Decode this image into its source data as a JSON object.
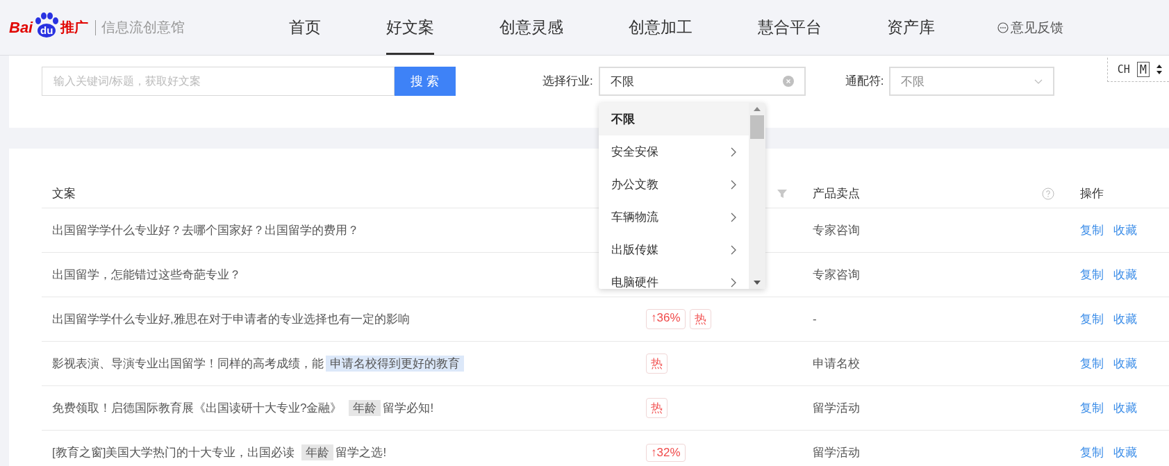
{
  "header": {
    "logo": {
      "parts": [
        "Bai",
        "du",
        "推广"
      ]
    },
    "subtitle": "信息流创意馆",
    "nav": [
      {
        "label": "首页",
        "selected": false
      },
      {
        "label": "好文案",
        "selected": true
      },
      {
        "label": "创意灵感",
        "selected": false
      },
      {
        "label": "创意加工",
        "selected": false
      },
      {
        "label": "慧合平台",
        "selected": false
      },
      {
        "label": "资产库",
        "selected": false
      }
    ],
    "feedback": "意见反馈"
  },
  "search": {
    "placeholder": "输入关键词/标题，获取好文案",
    "button": "搜 索"
  },
  "industry": {
    "label": "选择行业:",
    "value": "不限",
    "options": [
      {
        "label": "不限",
        "selected": true,
        "has_children": false
      },
      {
        "label": "安全安保",
        "selected": false,
        "has_children": true
      },
      {
        "label": "办公文教",
        "selected": false,
        "has_children": true
      },
      {
        "label": "车辆物流",
        "selected": false,
        "has_children": true
      },
      {
        "label": "出版传媒",
        "selected": false,
        "has_children": true
      },
      {
        "label": "电脑硬件",
        "selected": false,
        "has_children": true
      }
    ]
  },
  "wildcard": {
    "label": "通配符:",
    "value": "不限"
  },
  "ime": {
    "mode": "CH",
    "key": "M"
  },
  "table": {
    "columns": [
      {
        "label": "文案"
      },
      {
        "label": "产品卖点"
      },
      {
        "label": "操作"
      }
    ],
    "rows": [
      {
        "text": [
          {
            "text": "出国留学学什么专业好？去哪个国家好？出国留学的费用？",
            "kind": "plain"
          }
        ],
        "tags": [],
        "selling_point": "专家咨询",
        "actions": [
          "复制",
          "收藏"
        ]
      },
      {
        "text": [
          {
            "text": "出国留学，怎能错过这些奇葩专业？",
            "kind": "plain"
          }
        ],
        "tags": [],
        "selling_point": "专家咨询",
        "actions": [
          "复制",
          "收藏"
        ]
      },
      {
        "text": [
          {
            "text": "出国留学学什么专业好,雅思在对于申请者的专业选择也有一定的影响",
            "kind": "plain"
          }
        ],
        "tags": [
          {
            "text": "↑36%",
            "kind": "rise"
          },
          {
            "text": "热",
            "kind": "hot"
          }
        ],
        "selling_point": "-",
        "actions": [
          "复制",
          "收藏"
        ]
      },
      {
        "text": [
          {
            "text": "影视表演、导演专业出国留学！同样的高考成绩，能",
            "kind": "plain"
          },
          {
            "text": "申请名校得到更好的教育",
            "kind": "highlight"
          }
        ],
        "tags": [
          {
            "text": "热",
            "kind": "hot"
          }
        ],
        "selling_point": "申请名校",
        "actions": [
          "复制",
          "收藏"
        ]
      },
      {
        "text": [
          {
            "text": "免费领取！启德国际教育展《出国读研十大专业?金融》",
            "kind": "plain"
          },
          {
            "text": "年龄",
            "kind": "wildcard"
          },
          {
            "text": "留学必知!",
            "kind": "plain"
          }
        ],
        "tags": [
          {
            "text": "热",
            "kind": "hot"
          }
        ],
        "selling_point": "留学活动",
        "actions": [
          "复制",
          "收藏"
        ]
      },
      {
        "text": [
          {
            "text": "[教育之窗]美国大学热门的十大专业，出国必读",
            "kind": "plain"
          },
          {
            "text": "年龄",
            "kind": "wildcard"
          },
          {
            "text": "留学之选!",
            "kind": "plain"
          }
        ],
        "tags": [
          {
            "text": "↑32%",
            "kind": "rise"
          }
        ],
        "selling_point": "留学活动",
        "actions": [
          "复制",
          "收藏"
        ]
      }
    ]
  }
}
